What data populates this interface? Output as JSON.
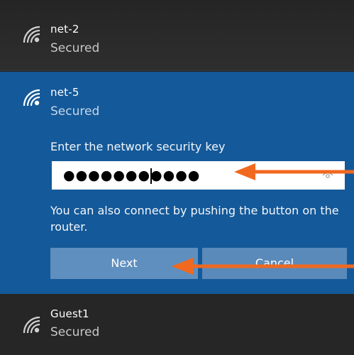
{
  "networks": [
    {
      "name": "net-2",
      "status": "Secured"
    },
    {
      "name": "net-5",
      "status": "Secured"
    },
    {
      "name": "Guest1",
      "status": "Secured"
    }
  ],
  "expanded": {
    "prompt": "Enter the network security key",
    "key_value": "●●●●●●●●●●●",
    "hint": "You can also connect by pushing the button on the router.",
    "next_label": "Next",
    "cancel_label": "Cancel"
  },
  "icons": {
    "wifi": "wifi-icon",
    "reveal": "eye-icon",
    "arrow": "arrow-left-icon"
  },
  "colors": {
    "expanded_bg": "#145999",
    "button_bg": "#5f8fbe",
    "annotation_arrow": "#f0691f"
  }
}
